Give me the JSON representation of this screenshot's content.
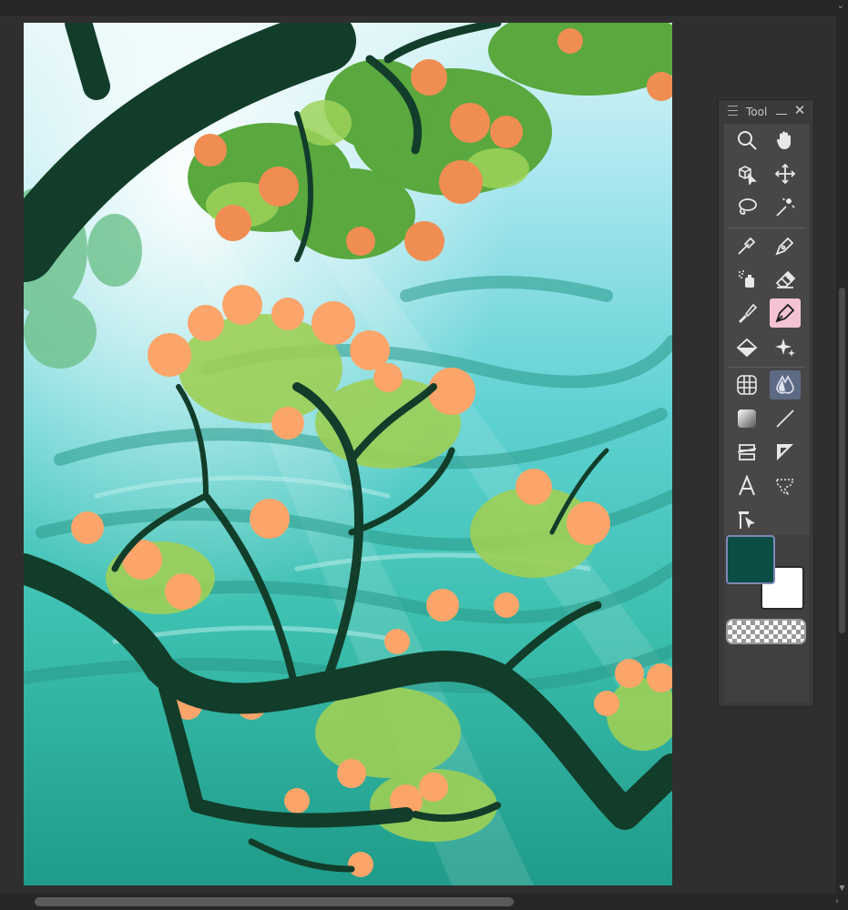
{
  "palette": {
    "title": "Tool",
    "tools": [
      {
        "name": "zoom",
        "icon": "magnifier-icon",
        "active": false
      },
      {
        "name": "hand",
        "icon": "hand-icon",
        "active": false
      },
      {
        "name": "operation",
        "icon": "object-select-icon",
        "active": false
      },
      {
        "name": "move-layer",
        "icon": "move-arrows-icon",
        "active": false
      },
      {
        "name": "selection",
        "icon": "lasso-icon",
        "active": false
      },
      {
        "name": "auto-select",
        "icon": "magic-wand-icon",
        "active": false
      },
      {
        "name": "eyedropper",
        "icon": "eyedropper-icon",
        "active": false
      },
      {
        "name": "pen",
        "icon": "pen-nib-icon",
        "active": false
      },
      {
        "name": "airbrush",
        "icon": "airbrush-icon",
        "active": false
      },
      {
        "name": "eraser",
        "icon": "eraser-icon",
        "active": false
      },
      {
        "name": "decoration",
        "icon": "decoration-brush-icon",
        "active": false
      },
      {
        "name": "brush",
        "icon": "brush-pen-icon",
        "active": true
      },
      {
        "name": "fill",
        "icon": "fill-bucket-icon",
        "active": false
      },
      {
        "name": "sparkle",
        "icon": "sparkle-icon",
        "active": false
      },
      {
        "name": "ruler-grid",
        "icon": "perspective-grid-icon",
        "active": false
      },
      {
        "name": "blend",
        "icon": "blend-drops-icon",
        "active": true
      },
      {
        "name": "gradient",
        "icon": "gradient-icon",
        "active": false
      },
      {
        "name": "figure",
        "icon": "line-icon",
        "active": false
      },
      {
        "name": "frame-border",
        "icon": "frame-border-icon",
        "active": false
      },
      {
        "name": "ruler",
        "icon": "ruler-icon",
        "active": false
      },
      {
        "name": "text",
        "icon": "text-A-icon",
        "active": false
      },
      {
        "name": "balloon",
        "icon": "balloon-icon",
        "active": false
      },
      {
        "name": "correct-line",
        "icon": "correct-line-icon",
        "active": false
      }
    ],
    "colors": {
      "main": "#0c4d45",
      "sub": "#ffffff",
      "transparent_label": "transparent-swatch"
    }
  },
  "colors": {
    "app_background": "#2f2f2f",
    "panel": "#3a3a3a",
    "active_tool_pink": "#f3c3d1",
    "active_tool_blue": "#5d6a84"
  }
}
